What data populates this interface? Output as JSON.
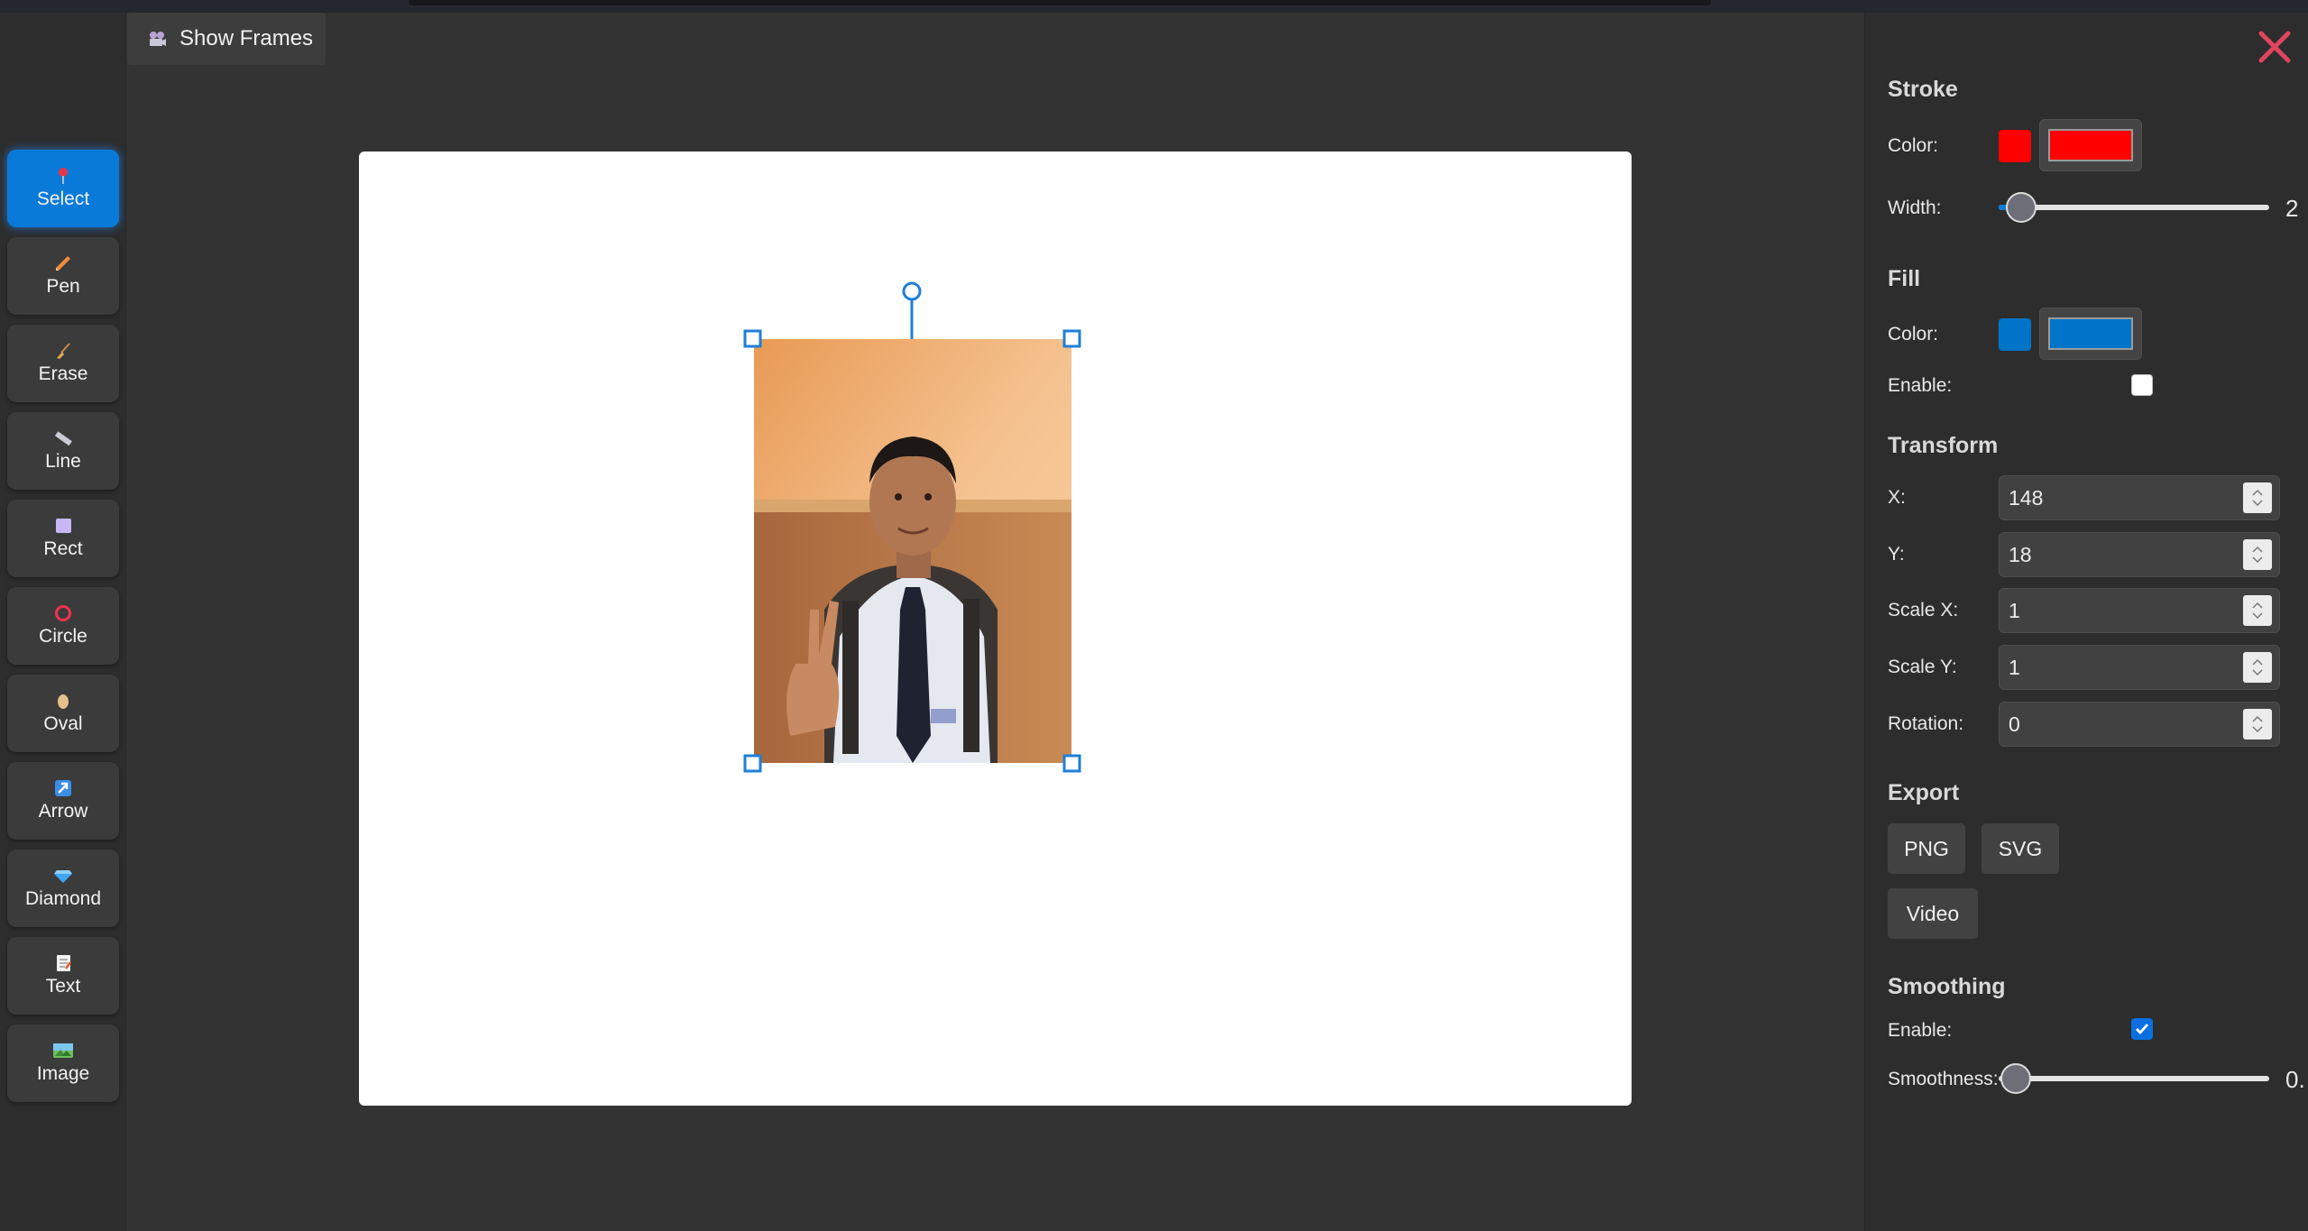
{
  "top_button": {
    "label": "Show Frames",
    "icon": "film-projector-icon"
  },
  "tools": [
    {
      "label": "Select",
      "icon": "pushpin-icon",
      "active": true
    },
    {
      "label": "Pen",
      "icon": "pencil-icon",
      "active": false
    },
    {
      "label": "Erase",
      "icon": "broom-icon",
      "active": false
    },
    {
      "label": "Line",
      "icon": "ruler-icon",
      "active": false
    },
    {
      "label": "Rect",
      "icon": "square-icon",
      "active": false
    },
    {
      "label": "Circle",
      "icon": "circle-icon",
      "active": false
    },
    {
      "label": "Oval",
      "icon": "egg-icon",
      "active": false
    },
    {
      "label": "Arrow",
      "icon": "arrow-icon",
      "active": false
    },
    {
      "label": "Diamond",
      "icon": "diamond-icon",
      "active": false
    },
    {
      "label": "Text",
      "icon": "memo-icon",
      "active": false
    },
    {
      "label": "Image",
      "icon": "picture-icon",
      "active": false
    }
  ],
  "panel": {
    "stroke": {
      "title": "Stroke",
      "color_label": "Color:",
      "color": "#ff0000",
      "width_label": "Width:",
      "width_value": "2",
      "width_fraction": 0.02
    },
    "fill": {
      "title": "Fill",
      "color_label": "Color:",
      "color": "#0074c8",
      "enable_label": "Enable:",
      "enabled": false
    },
    "transform": {
      "title": "Transform",
      "fields": [
        {
          "label": "X:",
          "value": "148"
        },
        {
          "label": "Y:",
          "value": "18"
        },
        {
          "label": "Scale X:",
          "value": "1"
        },
        {
          "label": "Scale Y:",
          "value": "1"
        },
        {
          "label": "Rotation:",
          "value": "0"
        }
      ]
    },
    "export": {
      "title": "Export",
      "png_label": "PNG",
      "svg_label": "SVG",
      "video_label": "Video"
    },
    "smoothing": {
      "title": "Smoothing",
      "enable_label": "Enable:",
      "enabled": true,
      "smoothness_label": "Smoothness:",
      "smoothness_value": "0.",
      "smoothness_fraction": 0.0
    }
  },
  "colors": {
    "accent": "#0a7ad8",
    "close": "#e0455e",
    "selection": "#1f7fd6"
  }
}
